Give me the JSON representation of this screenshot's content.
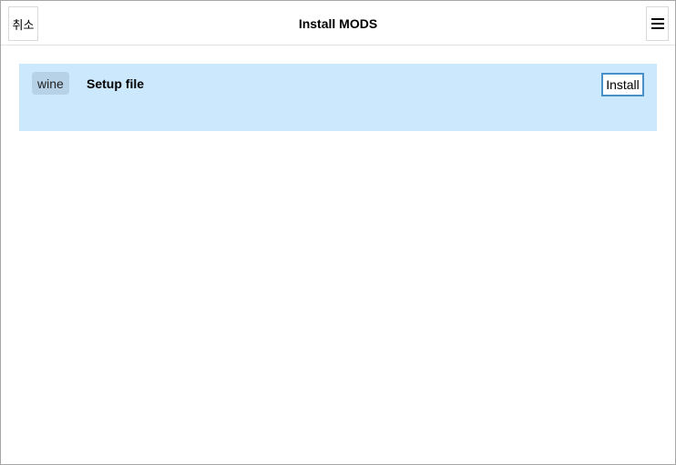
{
  "header": {
    "cancel_label": "취소",
    "title": "Install MODS",
    "menu_icon": "hamburger-menu-icon"
  },
  "list": {
    "items": [
      {
        "tag": "wine",
        "name": "Setup file",
        "action_label": "Install"
      }
    ]
  },
  "colors": {
    "item_background": "#cce8fd",
    "tag_background": "#b7d1e6",
    "install_border": "#4a90c8"
  }
}
